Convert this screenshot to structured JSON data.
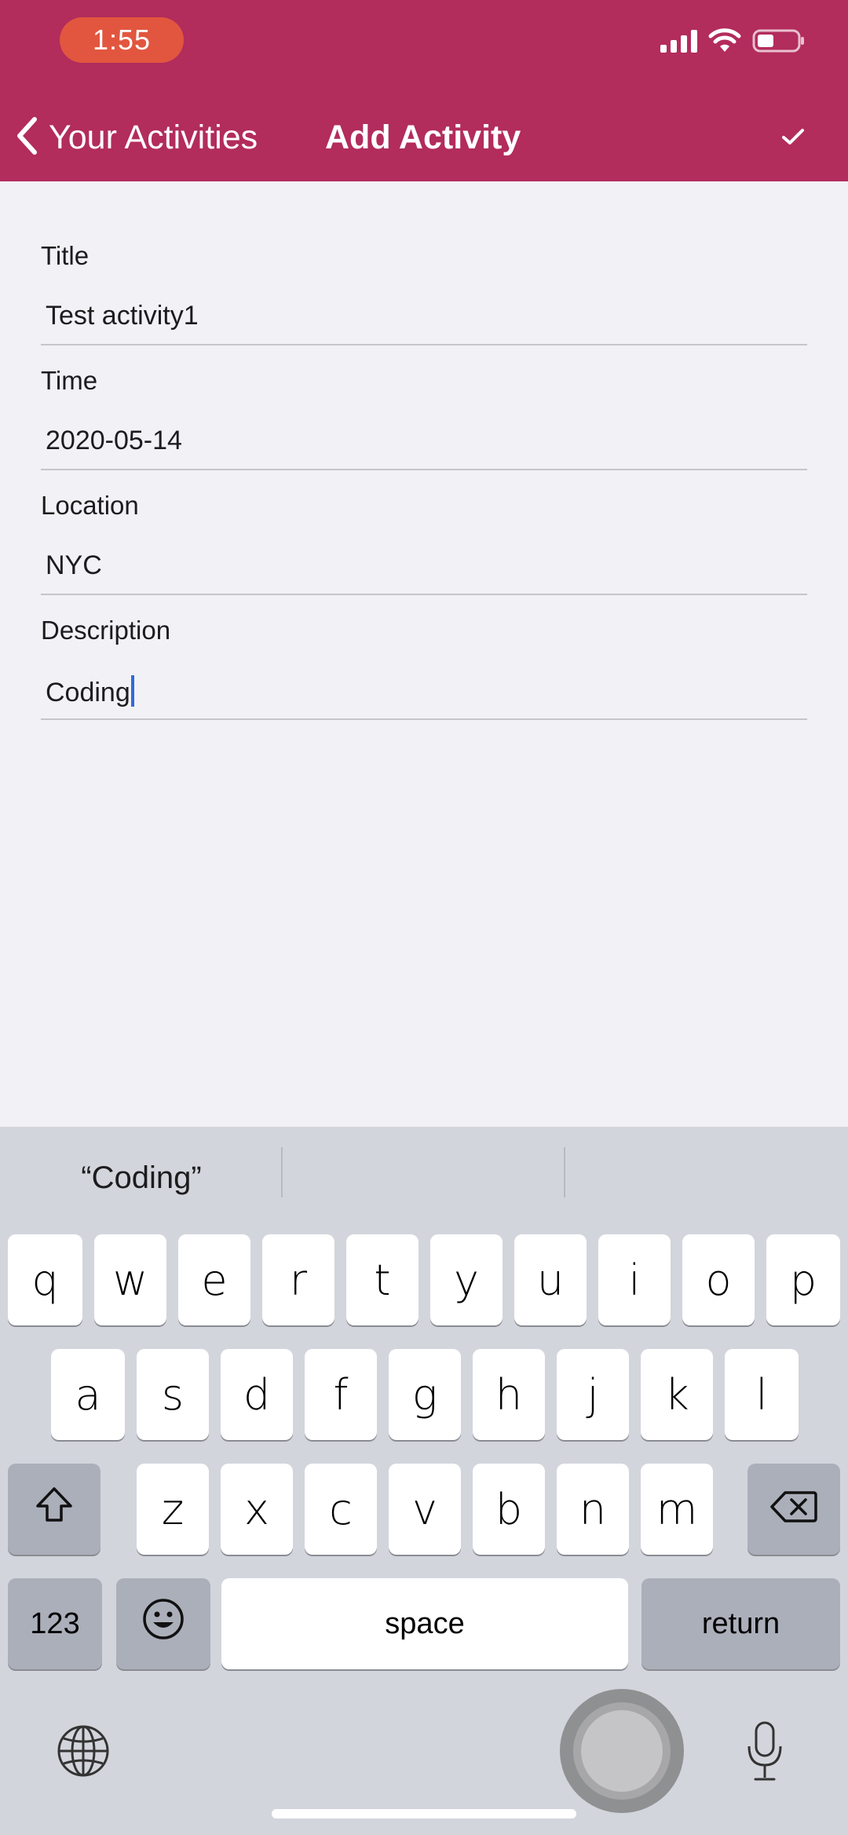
{
  "status_bar": {
    "time": "1:55"
  },
  "nav": {
    "back_label": "Your Activities",
    "title": "Add Activity"
  },
  "form": {
    "fields": [
      {
        "label": "Title",
        "value": "Test activity1"
      },
      {
        "label": "Time",
        "value": "2020-05-14"
      },
      {
        "label": "Location",
        "value": "NYC"
      },
      {
        "label": "Description",
        "value": "Coding"
      }
    ]
  },
  "keyboard": {
    "suggestions": [
      "“Coding”",
      "",
      ""
    ],
    "row1": [
      "q",
      "w",
      "e",
      "r",
      "t",
      "y",
      "u",
      "i",
      "o",
      "p"
    ],
    "row2": [
      "a",
      "s",
      "d",
      "f",
      "g",
      "h",
      "j",
      "k",
      "l"
    ],
    "row3": [
      "z",
      "x",
      "c",
      "v",
      "b",
      "n",
      "m"
    ],
    "numbers_label": "123",
    "space_label": "space",
    "return_label": "return"
  },
  "colors": {
    "header": "#b22c5c",
    "time_pill": "#e2563f",
    "background": "#f2f1f5",
    "keyboard": "#d3d5dc",
    "caret": "#2f6bdc"
  },
  "icons": [
    "signal-icon",
    "wifi-icon",
    "battery-icon",
    "chevron-left-icon",
    "checkmark-icon",
    "shift-icon",
    "backspace-icon",
    "emoji-icon",
    "globe-icon",
    "microphone-icon"
  ]
}
